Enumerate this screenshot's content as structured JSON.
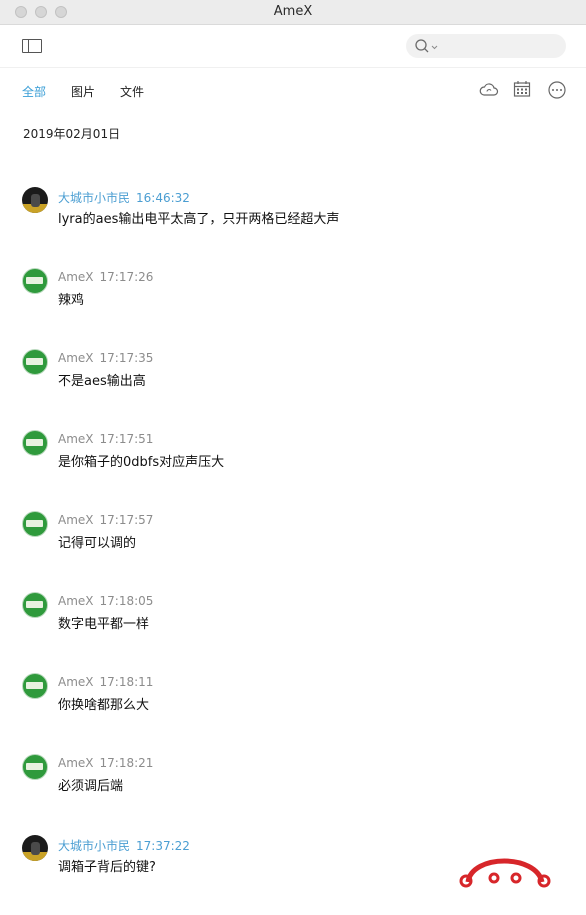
{
  "window": {
    "title": "AmeX"
  },
  "toolbar": {
    "sidebar_icon": "sidebar-toggle-icon",
    "search_icon": "search-icon"
  },
  "tabs": [
    {
      "label": "全部",
      "active": true
    },
    {
      "label": "图片",
      "active": false
    },
    {
      "label": "文件",
      "active": false
    }
  ],
  "tab_icons": [
    "cloud-sync-icon",
    "calendar-icon",
    "more-icon"
  ],
  "date": "2019年02月01日",
  "messages": [
    {
      "name": "大城市小市民",
      "time": "16:46:32",
      "text": "lyra的aes输出电平太高了，只开两格已经超大声",
      "avatar": "dark"
    },
    {
      "name": "AmeX",
      "time": "17:17:26",
      "text": "辣鸡",
      "avatar": "green"
    },
    {
      "name": "AmeX",
      "time": "17:17:35",
      "text": "不是aes输出高",
      "avatar": "green"
    },
    {
      "name": "AmeX",
      "time": "17:17:51",
      "text": "是你箱子的0dbfs对应声压大",
      "avatar": "green"
    },
    {
      "name": "AmeX",
      "time": "17:17:57",
      "text": "记得可以调的",
      "avatar": "green"
    },
    {
      "name": "AmeX",
      "time": "17:18:05",
      "text": "数字电平都一样",
      "avatar": "green"
    },
    {
      "name": "AmeX",
      "time": "17:18:11",
      "text": "你换啥都那么大",
      "avatar": "green"
    },
    {
      "name": "AmeX",
      "time": "17:18:21",
      "text": "必须调后端",
      "avatar": "green"
    },
    {
      "name": "大城市小市民",
      "time": "17:37:22",
      "text": "调箱子背后的键?",
      "avatar": "dark"
    }
  ],
  "colors": {
    "accent": "#3a9ed6",
    "sender_blue": "#4b9ed2",
    "sender_gray": "#8c8c8c",
    "logo_red": "#d7262a"
  }
}
